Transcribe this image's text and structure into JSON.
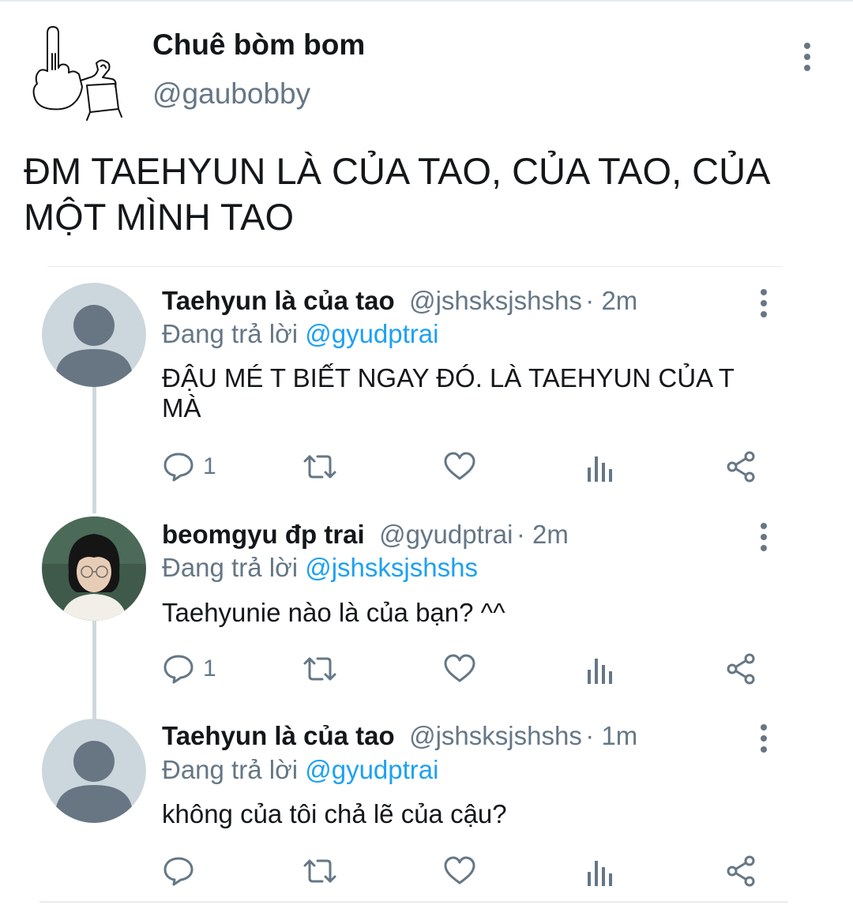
{
  "main_tweet": {
    "author_name": "Chuê bòm bom",
    "author_handle": "@gaubobby",
    "text": "ĐM TAEHYUN LÀ CỦA TAO, CỦA TAO, CỦA MỘT MÌNH TAO",
    "avatar_icon": "middle-finger-drawing-icon"
  },
  "replies": [
    {
      "name": "Taehyun là của tao",
      "handle": "@jshsksjshshs",
      "time": "2m",
      "replying_label": "Đang trả lời",
      "replying_to": "@gyudptrai",
      "text": "ĐẬU MÉ T BIẾT NGAY ĐÓ. LÀ TAEHYUN CỦA T MÀ",
      "reply_count": "1",
      "avatar": "default-avatar"
    },
    {
      "name": "beomgyu đp trai",
      "handle": "@gyudptrai",
      "time": "2m",
      "replying_label": "Đang trả lời",
      "replying_to": "@jshsksjshshs",
      "text": "Taehyunie nào là của bạn? ^^",
      "reply_count": "1",
      "avatar": "photo-avatar"
    },
    {
      "name": "Taehyun là của tao",
      "handle": "@jshsksjshshs",
      "time": "1m",
      "replying_label": "Đang trả lời",
      "replying_to": "@gyudptrai",
      "text": "không của tôi chả lẽ của cậu?",
      "reply_count": "",
      "avatar": "default-avatar"
    }
  ],
  "icons": [
    "reply-icon",
    "retweet-icon",
    "like-icon",
    "analytics-icon",
    "share-icon",
    "more-icon"
  ],
  "colors": {
    "text": "#14171a",
    "secondary": "#657786",
    "link": "#1da1f2",
    "avatar_bg": "#ccd6dd",
    "avatar_fg": "#687684"
  }
}
